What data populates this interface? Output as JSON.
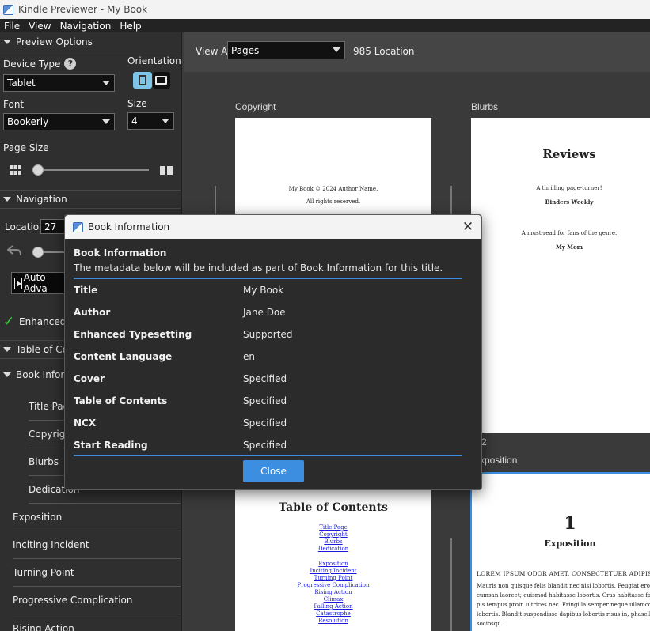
{
  "window": {
    "title": "Kindle Previewer - My Book"
  },
  "menu": [
    "File",
    "View",
    "Navigation",
    "Help"
  ],
  "sidebar": {
    "preview_options": "Preview Options",
    "device_type_label": "Device Type",
    "device_type_value": "Tablet",
    "orientation_label": "Orientation",
    "font_label": "Font",
    "font_value": "Bookerly",
    "size_label": "Size",
    "size_value": "4",
    "page_size_label": "Page Size",
    "navigation": "Navigation",
    "location_label": "Location",
    "location_value": "27",
    "auto_advance": "Auto-Adva",
    "enhanced_typesetting": "Enhanced T",
    "table_of_contents": "Table of Conte",
    "book_information": "Book Informa",
    "toc_items": [
      "Title Page",
      "Copyright",
      "Blurbs",
      "Dedication"
    ],
    "chapters": [
      "Exposition",
      "Inciting Incident",
      "Turning Point",
      "Progressive Complication",
      "Rising Action"
    ]
  },
  "main": {
    "view_all": "View All",
    "view_mode": "Pages",
    "location_count": "985 Location",
    "page_labels": [
      "Copyright",
      "Blurbs"
    ],
    "partial_label_number": "2",
    "partial_label_text": "xposition",
    "copyright_lines": [
      "My Book © 2024 Author Name.",
      "All rights reserved."
    ],
    "reviews": {
      "heading": "Reviews",
      "quote1": "A thrilling page-turner!",
      "source1": "Binders Weekly",
      "quote2": "A must-read for fans of the genre.",
      "source2": "My Mom"
    },
    "toc_page": {
      "heading": "Table of Contents",
      "front": [
        "Title Page",
        "Copyright",
        "Blurbs",
        "Dedication"
      ],
      "chapters": [
        "Exposition",
        "Inciting Incident",
        "Turning Point",
        "Progressive Complication",
        "Rising Action",
        "Climax",
        "Falling Action",
        "Catastrophe",
        "Resolution"
      ]
    },
    "chapter_page": {
      "number": "1",
      "title": "Exposition",
      "lead": "LOREM IPSUM ODOR AMET, CONSECTETUER ADIPISCING E",
      "lines": [
        "Mauris non quisque felis blandit nec nisi lobortis. Feugiat eros nec ev",
        "cumsan laoreet; euismod habitasse lobortis. Cras habitasse facilisi",
        "pis tempus proin ultrices nec. Fringilla semper neque ullamcorp",
        "lobortis. Blandit suspendisse dapibus lobortis risus in, phasellus tu",
        "sociosqu."
      ]
    }
  },
  "dialog": {
    "title": "Book Information",
    "heading": "Book Information",
    "description": "The metadata below will be included as part of Book Information for this title.",
    "rows": [
      {
        "key": "Title",
        "value": "My Book"
      },
      {
        "key": "Author",
        "value": "Jane Doe"
      },
      {
        "key": "Enhanced Typesetting",
        "value": "Supported"
      },
      {
        "key": "Content Language",
        "value": "en"
      },
      {
        "key": "Cover",
        "value": "Specified"
      },
      {
        "key": "Table of Contents",
        "value": "Specified"
      },
      {
        "key": "NCX",
        "value": "Specified"
      },
      {
        "key": "Start Reading",
        "value": "Specified"
      }
    ],
    "close_label": "Close",
    "accent": "#3c8fe0"
  }
}
